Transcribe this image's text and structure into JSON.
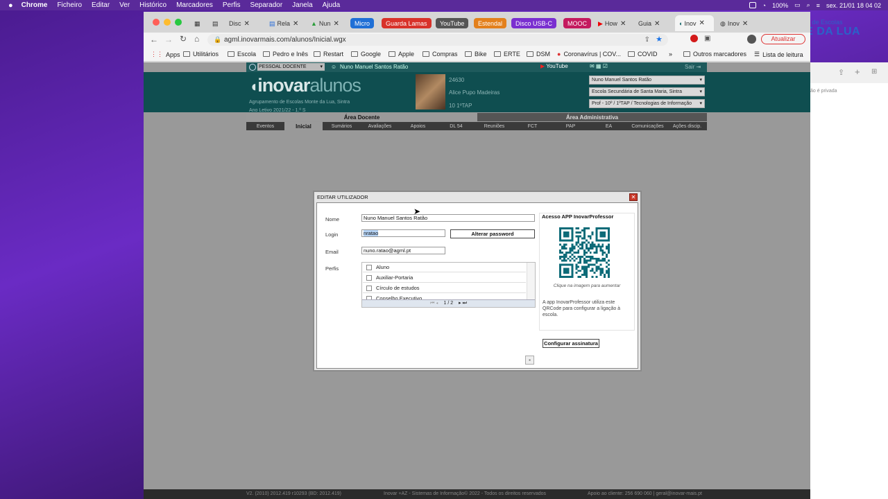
{
  "menubar": {
    "app": "Chrome",
    "items": [
      "Ficheiro",
      "Editar",
      "Ver",
      "Histórico",
      "Marcadores",
      "Perfis",
      "Separador",
      "Janela",
      "Ajuda"
    ],
    "battery": "100%",
    "clock": "sex. 21/01  18 04 02"
  },
  "tabs": [
    {
      "label": "Disc"
    },
    {
      "label": "Rela"
    },
    {
      "label": "Nun"
    },
    {
      "label": "Guia"
    },
    {
      "label": "Inov"
    },
    {
      "label": "Inov"
    },
    {
      "label": "How"
    }
  ],
  "pills": [
    {
      "label": "Micro",
      "color": "#1f6fd6"
    },
    {
      "label": "Guarda Lamas",
      "color": "#d8322a"
    },
    {
      "label": "YouTube",
      "color": "#555555"
    },
    {
      "label": "Estendal",
      "color": "#e3801c"
    },
    {
      "label": "Disco USB-C",
      "color": "#7a2fd0"
    },
    {
      "label": "MOOC",
      "color": "#c41a5e"
    }
  ],
  "toolbar": {
    "url": "agml.inovarmais.com/alunos/Inicial.wgx",
    "update_label": "Atualizar"
  },
  "bookmarks": [
    "Apps",
    "Utilitários",
    "Escola",
    "Pedro e Inês",
    "Restart",
    "Google",
    "Apple",
    "Compras",
    "Bike",
    "ERTE",
    "DSM",
    "Coronavírus | COV...",
    "COVID",
    "»",
    "Outros marcadores",
    "Lista de leitura"
  ],
  "watermark": {
    "line1": "Agrupamento de Escolas",
    "line2": "MONTE DA LUA"
  },
  "site": {
    "profile_select": "PESSOAL DOCENTE",
    "user_name": "Nuno Manuel Santos Ratão",
    "youtube": "YouTube",
    "logout": "Sair",
    "logo_bold": "inovar",
    "logo_light": "alunos",
    "org": "Agrupamento de Escolas Monte da Lua, Sintra",
    "year": "Ano Letivo 2021/22 - 1.º S",
    "student_number": "24630",
    "student_name": "Alice Pupo Madeiras",
    "student_class": "10 1ºTAP",
    "selects": [
      "Nuno Manuel Santos Ratão",
      "Escola Secundária de Santa Maria, Sintra",
      "Prof - 10º / 1ºTAP / Tecnologias de Informação"
    ],
    "area_docente": "Área Docente",
    "area_admin": "Área Administrativa",
    "subtabs": [
      "Eventos",
      "Inicial",
      "Sumários",
      "Avaliações",
      "Apoios",
      "DL 54",
      "Reuniões",
      "FCT",
      "PAP",
      "EA",
      "Comunicações",
      "Ações discip."
    ],
    "footer_left": "V2. (2010) 2012.419 r10293 (BD: 2012.419)",
    "footer_mid": "Inovar +AZ - Sistemas de Informação© 2022 - Todos os direitos reservados",
    "footer_right": "Apoio ao cliente: 256 690 060 | geral@inovar-mais.pt"
  },
  "modal": {
    "title": "EDITAR UTILIZADOR",
    "nome_label": "Nome",
    "nome_value": "Nuno Manuel Santos Ratão",
    "login_label": "Login",
    "login_value": "nratao",
    "password_button": "Alterar password",
    "email_label": "Email",
    "email_value": "nuno.ratao@agml.pt",
    "perfis_label": "Perfis",
    "perfis": [
      "Aluno",
      "Auxiliar-Portaria",
      "Círculo de estudos",
      "Conselho Executivo"
    ],
    "pager": "1 / 2",
    "app_title": "Acesso APP InovarProfessor",
    "qr_hint": "Clique na imagem para aumentar",
    "app_text": "A app InovarProfessor utiliza este QRCode para configurar a ligação à escola.",
    "signature_button": "Configurar assinatura"
  },
  "side_panel": {
    "private_text": "ão é privada"
  }
}
